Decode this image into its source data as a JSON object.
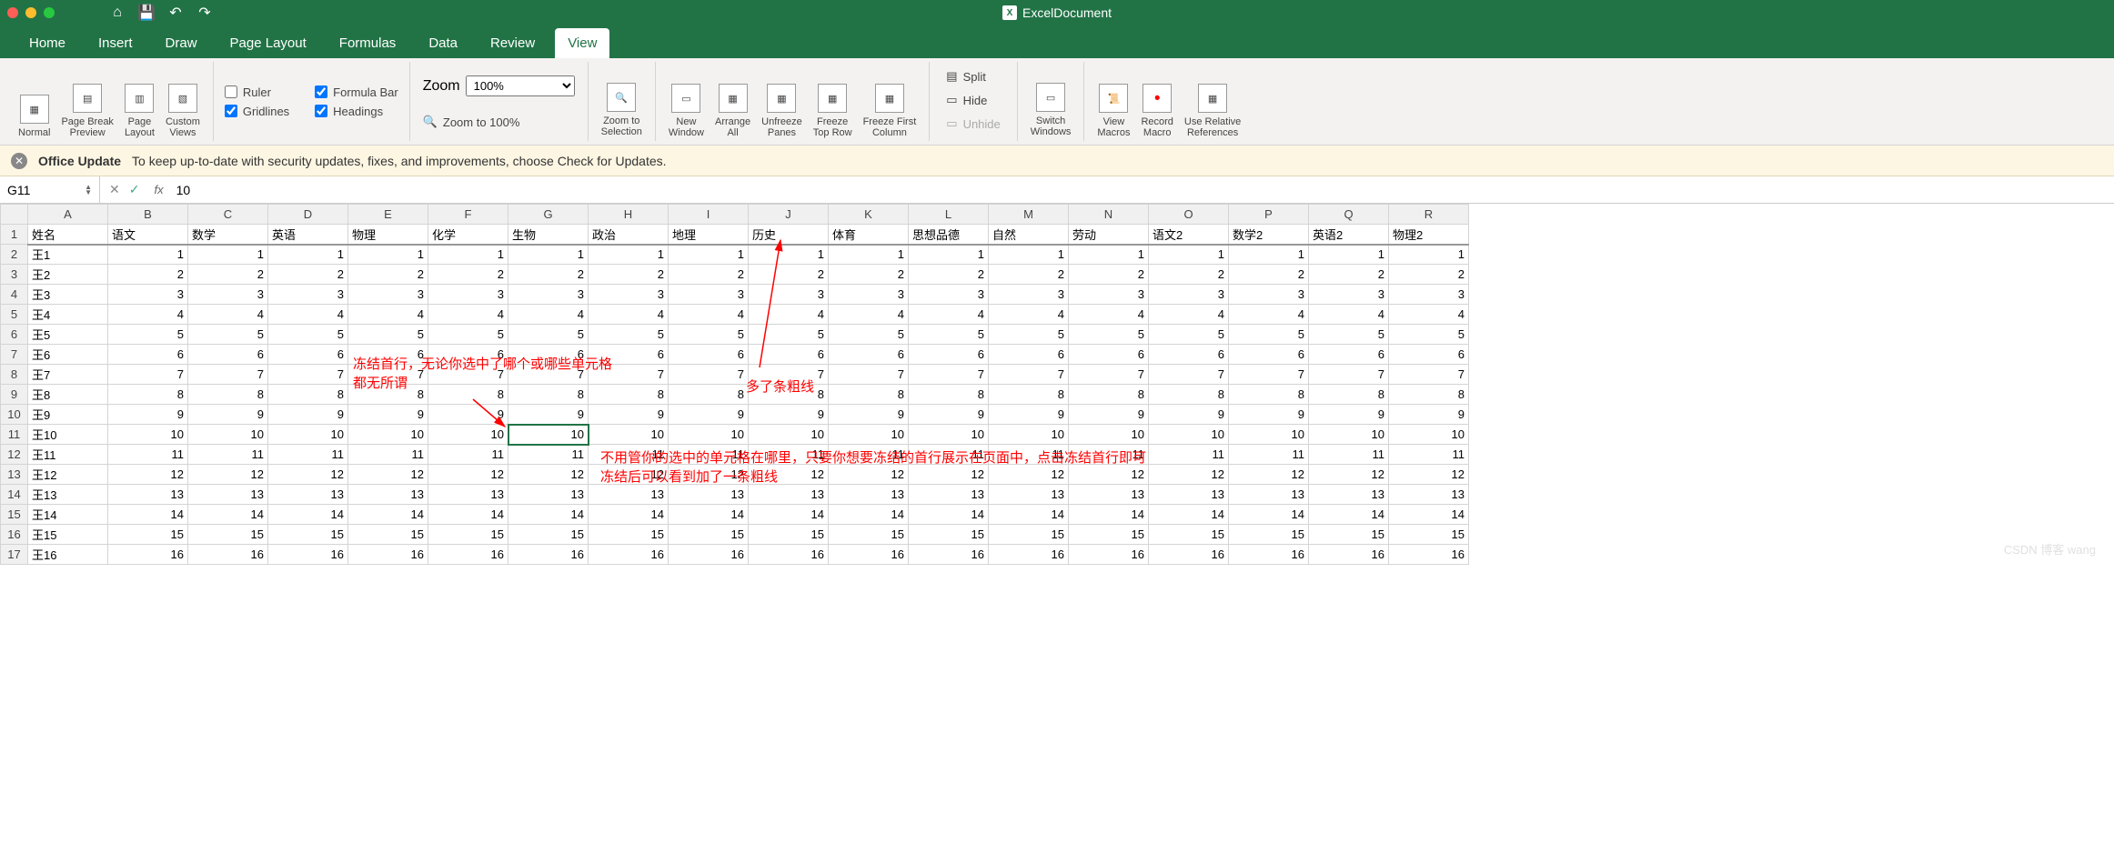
{
  "doc_title": "ExcelDocument",
  "tabs": [
    "Home",
    "Insert",
    "Draw",
    "Page Layout",
    "Formulas",
    "Data",
    "Review",
    "View"
  ],
  "active_tab": "View",
  "ribbon": {
    "views": {
      "normal": "Normal",
      "pbp": "Page Break\nPreview",
      "pl": "Page\nLayout",
      "cv": "Custom\nViews"
    },
    "show": {
      "ruler": "Ruler",
      "formula_bar": "Formula Bar",
      "gridlines": "Gridlines",
      "headings": "Headings"
    },
    "zoom": {
      "label": "Zoom",
      "value": "100%",
      "to100": "Zoom to 100%",
      "tosel": "Zoom to\nSelection"
    },
    "window": {
      "new": "New\nWindow",
      "arrange": "Arrange\nAll",
      "unfreeze": "Unfreeze\nPanes",
      "toprow": "Freeze\nTop Row",
      "firstcol": "Freeze First\nColumn",
      "split": "Split",
      "hide": "Hide",
      "unhide": "Unhide",
      "switch": "Switch\nWindows"
    },
    "macros": {
      "view": "View\nMacros",
      "record": "Record\nMacro",
      "relref": "Use Relative\nReferences"
    }
  },
  "msgbar": {
    "title": "Office Update",
    "text": "To keep up-to-date with security updates, fixes, and improvements, choose Check for Updates."
  },
  "namebox": "G11",
  "formula": "10",
  "columns": [
    "A",
    "B",
    "C",
    "D",
    "E",
    "F",
    "G",
    "H",
    "I",
    "J",
    "K",
    "L",
    "M",
    "N",
    "O",
    "P",
    "Q",
    "R"
  ],
  "headers": [
    "姓名",
    "语文",
    "数学",
    "英语",
    "物理",
    "化学",
    "生物",
    "政治",
    "地理",
    "历史",
    "体育",
    "思想品德",
    "自然",
    "劳动",
    "语文2",
    "数学2",
    "英语2",
    "物理2"
  ],
  "rows": [
    {
      "n": "王1",
      "v": 1
    },
    {
      "n": "王2",
      "v": 2
    },
    {
      "n": "王3",
      "v": 3
    },
    {
      "n": "王4",
      "v": 4
    },
    {
      "n": "王5",
      "v": 5
    },
    {
      "n": "王6",
      "v": 6
    },
    {
      "n": "王7",
      "v": 7
    },
    {
      "n": "王8",
      "v": 8
    },
    {
      "n": "王9",
      "v": 9
    },
    {
      "n": "王10",
      "v": 10
    },
    {
      "n": "王11",
      "v": 11
    },
    {
      "n": "王12",
      "v": 12
    },
    {
      "n": "王13",
      "v": 13
    },
    {
      "n": "王14",
      "v": 14
    },
    {
      "n": "王15",
      "v": 15
    },
    {
      "n": "王16",
      "v": 16
    }
  ],
  "selected": {
    "row": 11,
    "col": "G"
  },
  "annotations": {
    "a1": "冻结首行，无论你选中了哪个或哪些单元格\n都无所谓",
    "a2": "多了条粗线",
    "a3": "不用管你的选中的单元格在哪里，只要你想要冻结的首行展示在页面中，点击冻结首行即可\n冻结后可以看到加了一条粗线"
  },
  "watermark": "CSDN 博客 wang"
}
